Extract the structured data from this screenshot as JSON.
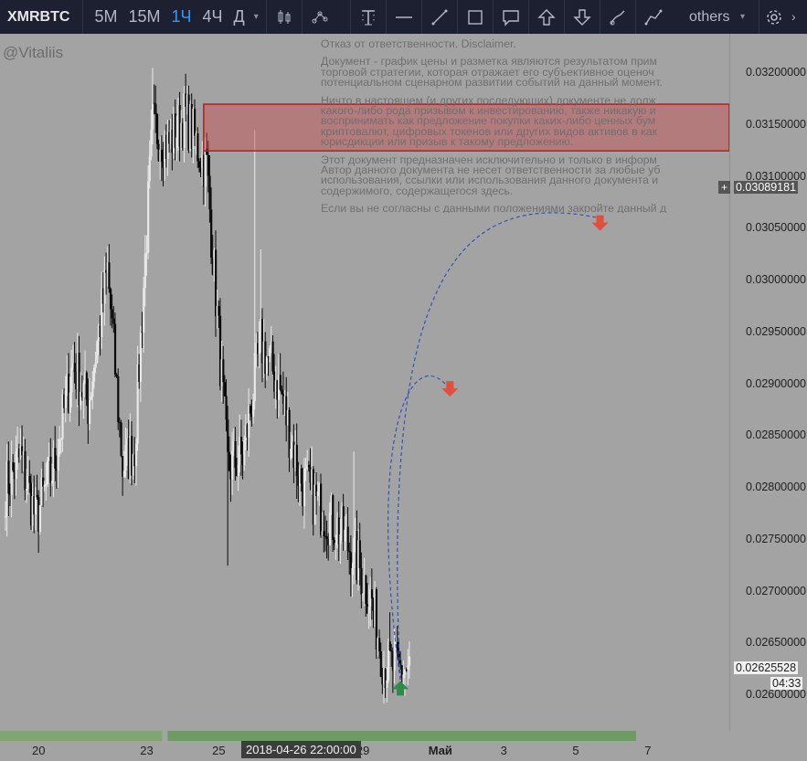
{
  "toolbar": {
    "symbol": "XMRBTC",
    "timeframes": [
      {
        "label": "5M",
        "active": false
      },
      {
        "label": "15M",
        "active": false
      },
      {
        "label": "1Ч",
        "active": true
      },
      {
        "label": "4Ч",
        "active": false
      },
      {
        "label": "Д",
        "active": false
      }
    ],
    "others_label": "others",
    "tools": [
      "candles-icon",
      "indicators-icon",
      "text-tool-icon",
      "horizontal-line-icon",
      "trend-line-icon",
      "rectangle-icon",
      "callout-icon",
      "arrow-up-icon",
      "arrow-down-icon",
      "brush-icon",
      "path-icon"
    ]
  },
  "author": "@Vitaliis",
  "disclaimer": {
    "paragraphs": [
      [
        "Отказ от ответственности. Disclaimer."
      ],
      [
        "Документ - график цены и разметка являются результатом прим",
        "торговой стратегии, которая отражает его субъективное оценоч",
        "потенциальном сценарном развитии событий на данный момент."
      ],
      [
        "Ничто в настоящем (и других последующих) документе не долж",
        "какого-либо рода призывом к инвестированию, также никакую и",
        "воспринимать как предложение покупки каких-либо ценных бум",
        "криптовалют, цифровых токенов или других видов активов в как",
        "юрисдикции или призыв к такому предложению."
      ],
      [
        "Этот документ предназначен исключительно и только в информ",
        "Автор данного документа не несет ответственности за любые уб",
        "использования, ссылки или использования данного документа и",
        "содержимого, содержащегося здесь."
      ],
      [
        "Если вы не согласны с данными положениями закройте данный д"
      ]
    ]
  },
  "chart_data": {
    "type": "candlestick",
    "symbol": "XMRBTC",
    "interval": "1Ч",
    "ylim": [
      0.02585,
      0.0322
    ],
    "price_ticks": [
      "0.03200000",
      "0.03150000",
      "0.03100000",
      "0.03050000",
      "0.03000000",
      "0.02950000",
      "0.02900000",
      "0.02850000",
      "0.02800000",
      "0.02750000",
      "0.02700000",
      "0.02650000",
      "0.02600000"
    ],
    "price_tick_values": [
      0.032,
      0.0315,
      0.031,
      0.0305,
      0.03,
      0.0295,
      0.029,
      0.0285,
      0.028,
      0.0275,
      0.027,
      0.0265,
      0.026
    ],
    "x_labels": [
      "20",
      "23",
      "25",
      "29",
      "Май",
      "3",
      "5",
      "7"
    ],
    "x_label_bar_index": [
      0,
      72,
      120,
      216,
      264,
      312,
      360,
      408
    ],
    "bars_shown": 476,
    "bars_with_data": 270,
    "anchor_points": [
      [
        0,
        0.028
      ],
      [
        10,
        0.0283
      ],
      [
        20,
        0.0277
      ],
      [
        32,
        0.0282
      ],
      [
        45,
        0.0292
      ],
      [
        55,
        0.0288
      ],
      [
        68,
        0.0301
      ],
      [
        78,
        0.0282
      ],
      [
        86,
        0.0284
      ],
      [
        98,
        0.0315
      ],
      [
        108,
        0.0313
      ],
      [
        120,
        0.0316
      ],
      [
        130,
        0.0312
      ],
      [
        134,
        0.0311
      ],
      [
        148,
        0.0282
      ],
      [
        158,
        0.0283
      ],
      [
        170,
        0.0294
      ],
      [
        182,
        0.029
      ],
      [
        196,
        0.0281
      ],
      [
        210,
        0.0278
      ],
      [
        222,
        0.0276
      ],
      [
        234,
        0.0273
      ],
      [
        244,
        0.0269
      ],
      [
        252,
        0.0263
      ],
      [
        262,
        0.02625
      ]
    ],
    "wicks": [
      [
        98,
        0.03205
      ],
      [
        134,
        0.03125
      ],
      [
        148,
        0.02725
      ],
      [
        166,
        0.03145
      ],
      [
        170,
        0.0303
      ],
      [
        232,
        0.02835
      ],
      [
        256,
        0.0268
      ]
    ],
    "last_price_label": "0.02625528",
    "last_price_value": 0.02625528,
    "countdown": "04:33",
    "crosshair_price_label": "0.03089181",
    "crosshair_price_value": 0.03089181,
    "crosshair_plus": "+",
    "crosshair_date": "2018-04-26 22:00:00",
    "resistance_zone": {
      "from_bar": 132,
      "to_bar": 476,
      "price_low": 0.03125,
      "price_high": 0.0317,
      "color": "#c84b4b"
    },
    "projection_paths": [
      {
        "points": [
          [
            263,
            0.02615
          ],
          [
            240,
            0.0285
          ],
          [
            270,
            0.02945
          ],
          [
            296,
            0.02895
          ]
        ],
        "color": "#2e55b5"
      },
      {
        "points": [
          [
            263,
            0.02615
          ],
          [
            250,
            0.03
          ],
          [
            300,
            0.0309
          ],
          [
            396,
            0.0306
          ]
        ],
        "color": "#2e55b5"
      }
    ],
    "markers": [
      {
        "type": "arrow-up",
        "bar": 263,
        "price": 0.02605,
        "color": "#2e8b4a"
      },
      {
        "type": "arrow-down",
        "bar": 296,
        "price": 0.02895,
        "color": "#e0503c"
      },
      {
        "type": "arrow-down",
        "bar": 396,
        "price": 0.03055,
        "color": "#e0503c"
      }
    ],
    "session_bar": [
      {
        "from_bar": 0,
        "to_bar": 108,
        "color": "#7fa572"
      },
      {
        "from_bar": 108,
        "to_bar": 420,
        "color": "#6e9b64"
      }
    ]
  }
}
